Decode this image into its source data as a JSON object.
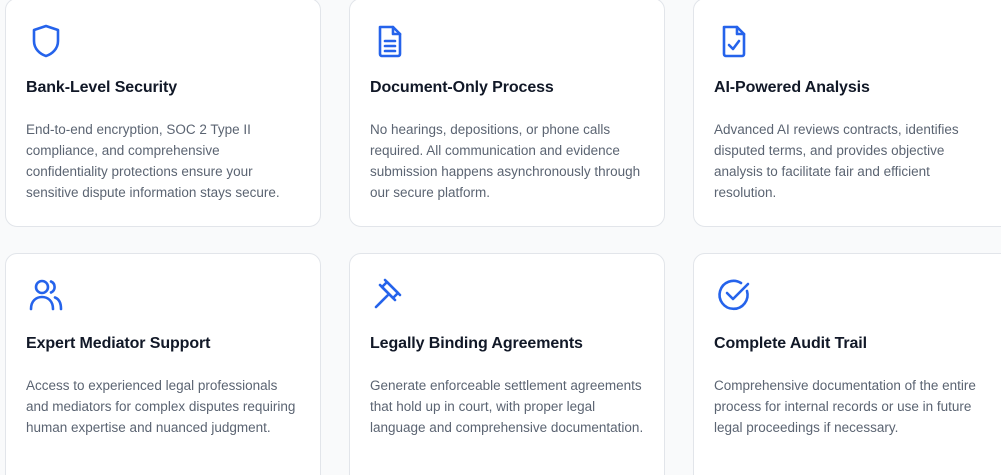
{
  "accent_color": "#2563eb",
  "features": [
    {
      "icon": "shield-icon",
      "title": "Bank-Level Security",
      "description": "End-to-end encryption, SOC 2 Type II compliance, and comprehensive confidentiality protections ensure your sensitive dispute information stays secure."
    },
    {
      "icon": "document-text-icon",
      "title": "Document-Only Process",
      "description": "No hearings, depositions, or phone calls required. All communication and evidence submission happens asynchronously through our secure platform."
    },
    {
      "icon": "document-check-icon",
      "title": "AI-Powered Analysis",
      "description": "Advanced AI reviews contracts, identifies disputed terms, and provides objective analysis to facilitate fair and efficient resolution."
    },
    {
      "icon": "users-icon",
      "title": "Expert Mediator Support",
      "description": "Access to experienced legal professionals and mediators for complex disputes requiring human expertise and nuanced judgment."
    },
    {
      "icon": "gavel-icon",
      "title": "Legally Binding Agreements",
      "description": "Generate enforceable settlement agreements that hold up in court, with proper legal language and comprehensive documentation."
    },
    {
      "icon": "check-circle-icon",
      "title": "Complete Audit Trail",
      "description": "Comprehensive documentation of the entire process for internal records or use in future legal proceedings if necessary."
    }
  ]
}
